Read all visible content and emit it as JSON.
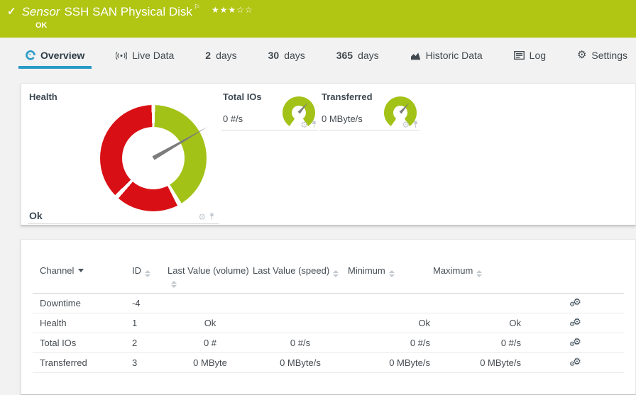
{
  "colors": {
    "header_green": "#b1c513",
    "gauge_green": "#a2c217",
    "alert_red": "#d80f14",
    "accent_blue": "#2a9ac6"
  },
  "header": {
    "check_icon": "✓",
    "kind_label": "Sensor",
    "title": "SSH SAN Physical Disk",
    "flag_icon": "⚐",
    "stars": "★★★☆☆",
    "status": "OK"
  },
  "tabs": [
    {
      "label": "Overview",
      "active": true
    },
    {
      "label": "Live Data"
    },
    {
      "num": "2",
      "label": "days"
    },
    {
      "num": "30",
      "label": "days"
    },
    {
      "num": "365",
      "label": "days"
    },
    {
      "label": "Historic Data"
    },
    {
      "label": "Log"
    },
    {
      "label": "Settings",
      "gear_icon": "⚙"
    }
  ],
  "gauges": {
    "health": {
      "label": "Health",
      "value": "Ok",
      "needle_deg": 60,
      "segments": [
        {
          "color": "green",
          "from_deg": 2,
          "to_deg": 148
        },
        {
          "color": "red",
          "from_deg": 153,
          "to_deg": 221
        },
        {
          "color": "red",
          "from_deg": 226,
          "to_deg": 358
        }
      ]
    },
    "total_ios": {
      "label": "Total IOs",
      "value": "0 #/s",
      "needle_deg": 42
    },
    "transferred": {
      "label": "Transferred",
      "value": "0 MByte/s",
      "needle_deg": 42
    },
    "tile_icons": {
      "gear": "⚙"
    }
  },
  "table": {
    "headers": {
      "channel": "Channel",
      "id": "ID",
      "volume": "Last Value (volume)",
      "speed": "Last Value (speed)",
      "min": "Minimum",
      "max": "Maximum"
    },
    "rows": [
      {
        "channel": "Downtime",
        "id": "-4",
        "volume": "",
        "speed": "",
        "min": "",
        "max": ""
      },
      {
        "channel": "Health",
        "id": "1",
        "volume": "Ok",
        "speed": "",
        "min": "Ok",
        "max": "Ok"
      },
      {
        "channel": "Total IOs",
        "id": "2",
        "volume": "0 #",
        "speed": "0 #/s",
        "min": "0 #/s",
        "max": "0 #/s"
      },
      {
        "channel": "Transferred",
        "id": "3",
        "volume": "0 MByte",
        "speed": "0 MByte/s",
        "min": "0 MByte/s",
        "max": "0 MByte/s"
      }
    ],
    "row_icons": {
      "cog_small": "⚙",
      "cog_big": "⚙"
    }
  }
}
